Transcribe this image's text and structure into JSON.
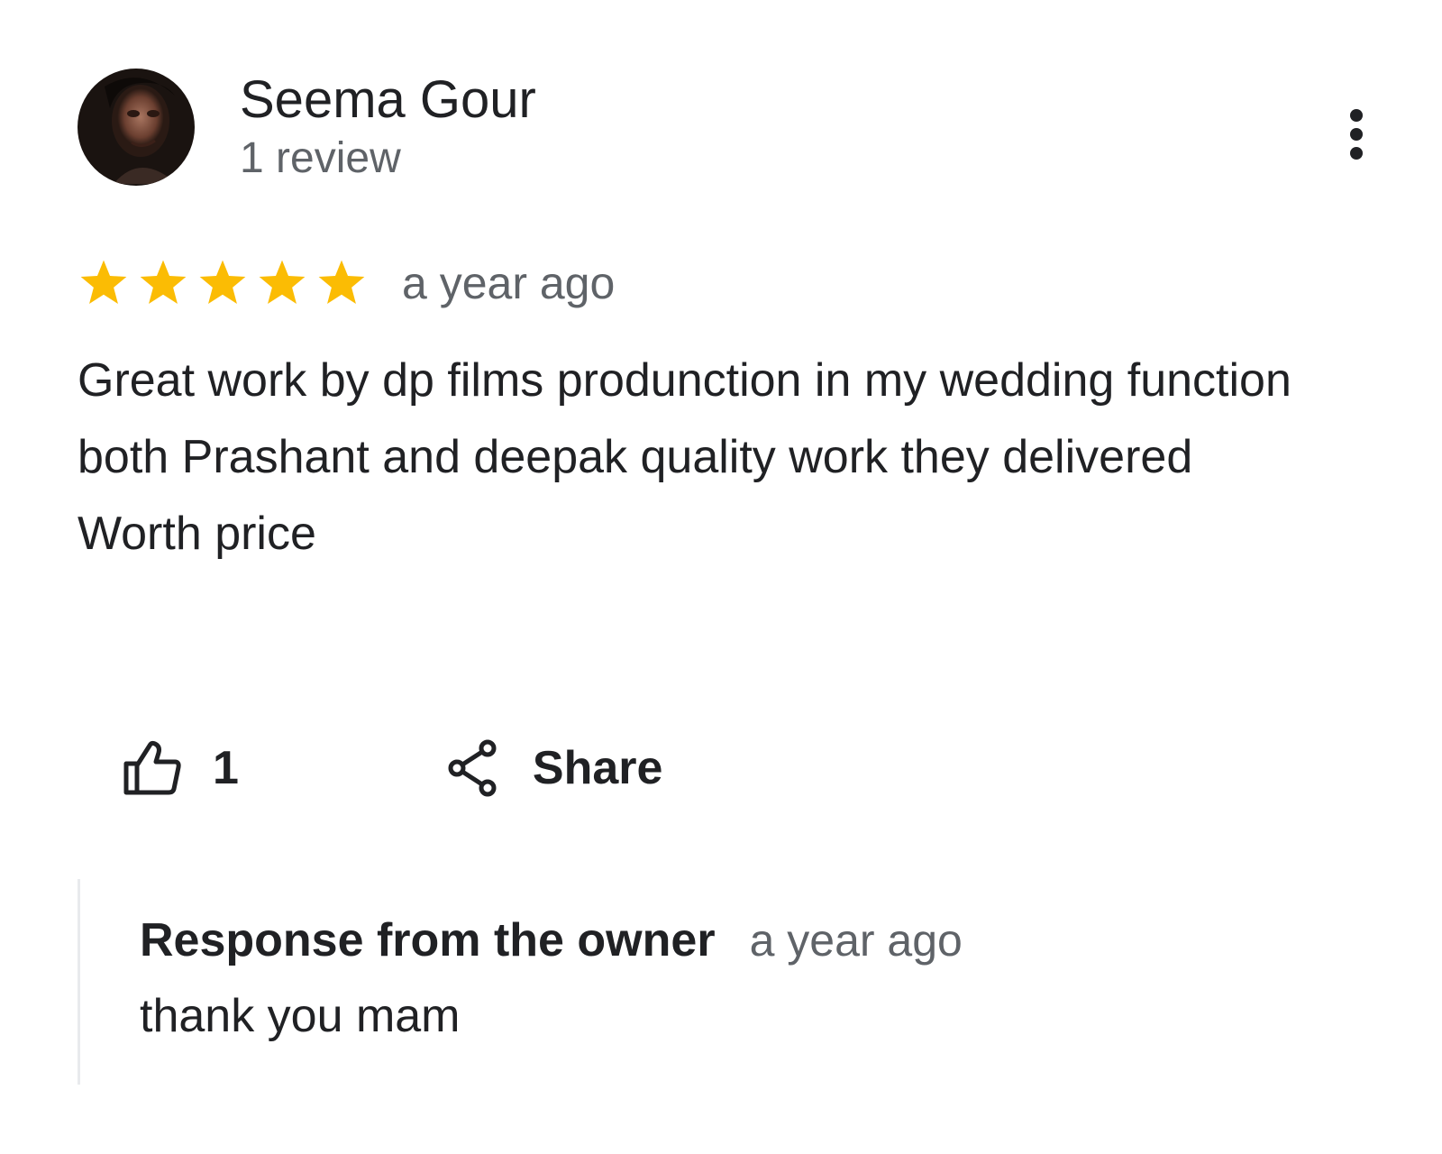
{
  "reviewer": {
    "name": "Seema Gour",
    "review_count": "1 review",
    "avatar_icon": "user-photo-avatar"
  },
  "menu": {
    "icon": "more-vert-icon"
  },
  "review": {
    "rating": 5,
    "max_rating": 5,
    "star_color": "#fbbc04",
    "date": "a year ago",
    "text": "Great work by dp films produnction in my wedding function both Prashant and deepak quality work they delivered\nWorth price"
  },
  "actions": {
    "like_icon": "thumb-up-icon",
    "like_count": "1",
    "share_icon": "share-icon",
    "share_label": "Share"
  },
  "owner_response": {
    "title": "Response from the owner",
    "date": "a year ago",
    "text": "thank you mam"
  }
}
